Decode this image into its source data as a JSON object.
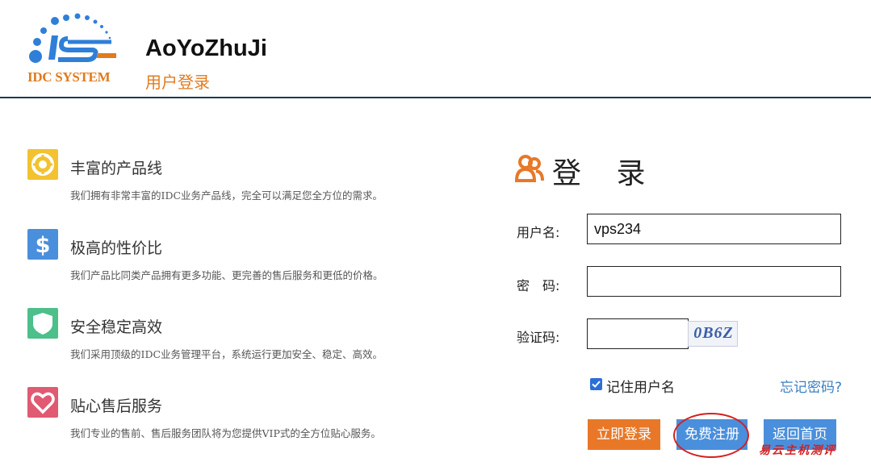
{
  "header": {
    "logo_text": "IDC SYSTEM",
    "site_name": "AoYoZhuJi",
    "page_subtitle": "用户登录"
  },
  "features": [
    {
      "icon": "lifebuoy-icon",
      "color": "#f2c230",
      "title": "丰富的产品线",
      "desc": "我们拥有非常丰富的IDC业务产品线，完全可以满足您全方位的需求。"
    },
    {
      "icon": "dollar-icon",
      "color": "#4a8fdc",
      "title": "极高的性价比",
      "desc": "我们产品比同类产品拥有更多功能、更完善的售后服务和更低的价格。"
    },
    {
      "icon": "shield-icon",
      "color": "#4cbf8a",
      "title": "安全稳定高效",
      "desc": "我们采用顶级的IDC业务管理平台，系统运行更加安全、稳定、高效。"
    },
    {
      "icon": "heart-icon",
      "color": "#e05a72",
      "title": "贴心售后服务",
      "desc": "我们专业的售前、售后服务团队将为您提供VIP式的全方位贴心服务。"
    }
  ],
  "login": {
    "title": "登 录",
    "icon": "users-icon",
    "accent": "#e87828",
    "username_label": "用户名:",
    "username_value": "vps234",
    "password_label": "密　码:",
    "password_value": "",
    "captcha_label": "验证码:",
    "captcha_value": "",
    "captcha_text": "0B6Z",
    "remember_label": "记住用户名",
    "remember_checked": true,
    "forgot_label": "忘记密码?",
    "login_button": "立即登录",
    "register_button": "免费注册",
    "home_button": "返回首页"
  },
  "watermark": "易云主机测评"
}
